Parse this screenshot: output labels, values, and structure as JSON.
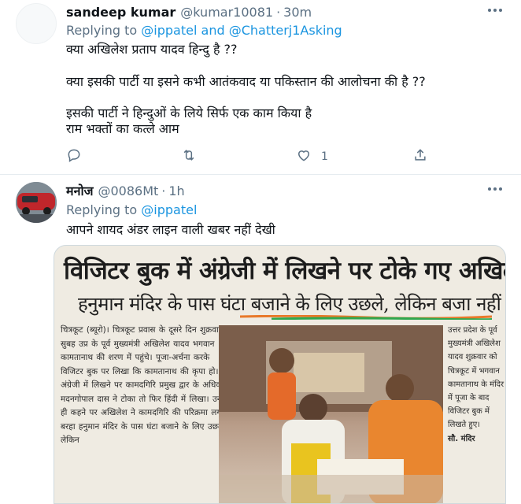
{
  "tweets": [
    {
      "name": "sandeep kumar",
      "handle": "@kumar10081",
      "dot": "·",
      "time": "30m",
      "replying_prefix": "Replying to ",
      "replying_to_1": "@ippatel",
      "replying_and": " and ",
      "replying_to_2": "@Chatterj1Asking",
      "text_lines": [
        "क्या अखिलेश प्रताप यादव हिन्दु है ??",
        "क्या इसकी पार्टी या इसने कभी आतंकवाद या पकिस्तान की आलोचना की है ??",
        "इसकी पार्टी ने हिन्दुओं के लिये सिर्फ एक काम किया है",
        "राम भक्तों का कत्ले आम"
      ],
      "like_count": "1",
      "more_icon": "more-dots-icon"
    },
    {
      "name": "मनोज",
      "handle": "@0086Mt",
      "dot": "·",
      "time": "1h",
      "replying_prefix": "Replying to ",
      "replying_to_1": "@ippatel",
      "text": "आपने शायद अंडर लाइन वाली खबर नहीं देखी",
      "more_icon": "more-dots-icon"
    }
  ],
  "newspaper": {
    "headline": "विजिटर बुक में अंग्रेजी में लिखने पर टोके गए अखिलेश",
    "subheadline": "हनुमान मंदिर के पास घंटा बजाने के लिए उछले, लेकिन बजा नहीं सके",
    "left_column": "चित्रकूट (ब्यूरो)। चित्रकूट प्रवास के दूसरे दिन शुक्रवार सुबह उप्र के पूर्व मुख्यमंत्री अखिलेश यादव भगवान कामतानाथ की शरण में पहुंचे। पूजा-अर्चना करके विजिटर बुक पर लिखा कि कामतानाथ की कृपा हो। अंग्रेजी में लिखने पर कामदगिरि प्रमुख द्वार के अधिकारी मदनगोपाल दास ने टोका तो फिर हिंदी में लिखा। उनके ही कहने पर अखिलेश ने कामदगिरि की परिक्रमा लगाई। बरहा हनुमान मंदिर के पास घंटा बजाने के लिए उछले, लेकिन",
    "right_column": "उत्तर प्रदेश के पूर्व मुख्यमंत्री अखिलेश यादव शुक्रवार को चित्रकूट में भगवान कामतानाथ के मंदिर में पूजा के बाद विजिटर बुक में लिखते हुए।",
    "right_byline": "सौ. मंदिर",
    "underline_colors": [
      "#e8792a",
      "#2fa84f"
    ]
  },
  "colors": {
    "link": "#1b95e0",
    "muted": "#5b7083",
    "text": "#0f1419"
  }
}
